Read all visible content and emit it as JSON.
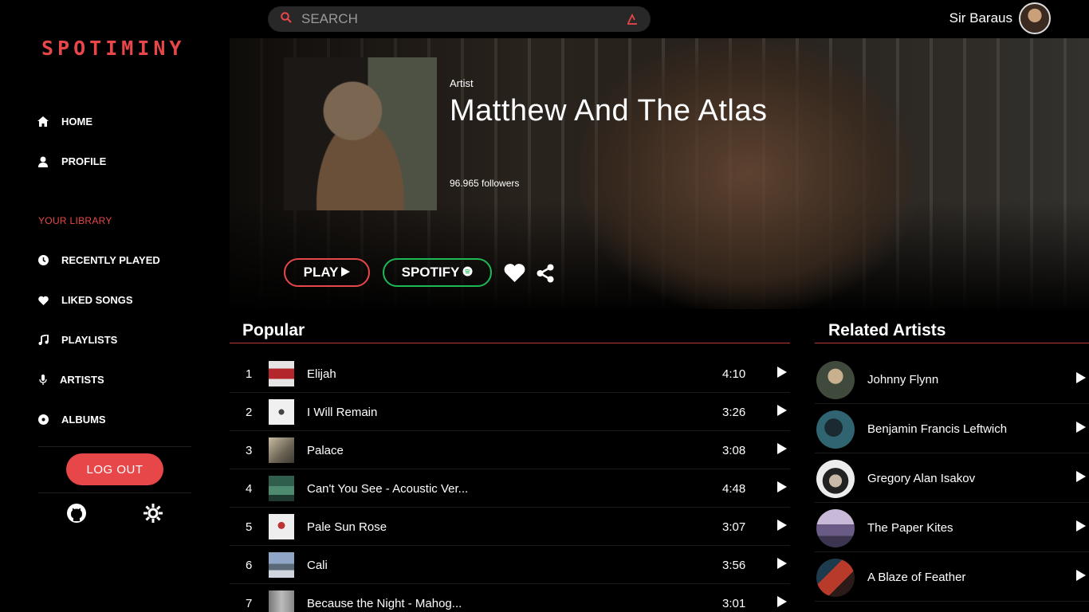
{
  "app": {
    "logo": "SPOTIMINY"
  },
  "search": {
    "placeholder": "SEARCH"
  },
  "user": {
    "name": "Sir Baraus"
  },
  "sidebar": {
    "items": [
      {
        "label": "HOME",
        "icon": "home-icon"
      },
      {
        "label": "PROFILE",
        "icon": "user-icon"
      }
    ],
    "library_header": "YOUR LIBRARY",
    "library": [
      {
        "label": "RECENTLY PLAYED",
        "icon": "clock-icon"
      },
      {
        "label": "LIKED SONGS",
        "icon": "heart-icon"
      },
      {
        "label": "PLAYLISTS",
        "icon": "music-note-icon"
      },
      {
        "label": "ARTISTS",
        "icon": "microphone-icon"
      },
      {
        "label": "ALBUMS",
        "icon": "disc-icon"
      }
    ],
    "logout": "LOG OUT"
  },
  "artist": {
    "kind": "Artist",
    "name": "Matthew And The Atlas",
    "followers": "96.965 followers",
    "play_label": "PLAY",
    "spotify_label": "SPOTIFY"
  },
  "popular": {
    "title": "Popular",
    "tracks": [
      {
        "num": "1",
        "name": "Elijah",
        "duration": "4:10"
      },
      {
        "num": "2",
        "name": "I Will Remain",
        "duration": "3:26"
      },
      {
        "num": "3",
        "name": "Palace",
        "duration": "3:08"
      },
      {
        "num": "4",
        "name": "Can't You See - Acoustic Ver...",
        "duration": "4:48"
      },
      {
        "num": "5",
        "name": "Pale Sun Rose",
        "duration": "3:07"
      },
      {
        "num": "6",
        "name": "Cali",
        "duration": "3:56"
      },
      {
        "num": "7",
        "name": "Because the Night - Mahog...",
        "duration": "3:01"
      }
    ]
  },
  "related": {
    "title": "Related Artists",
    "artists": [
      {
        "name": "Johnny Flynn"
      },
      {
        "name": "Benjamin Francis Leftwich"
      },
      {
        "name": "Gregory Alan Isakov"
      },
      {
        "name": "The Paper Kites"
      },
      {
        "name": "A Blaze of Feather"
      }
    ]
  },
  "colors": {
    "accent": "#e8474a",
    "spotify": "#1db954",
    "background": "#000000"
  }
}
